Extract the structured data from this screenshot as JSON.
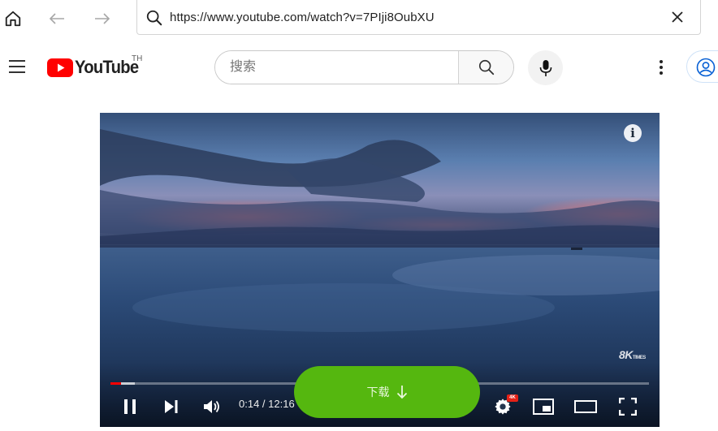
{
  "browser": {
    "url": "https://www.youtube.com/watch?v=7PIji8OubXU",
    "icons": {
      "home": "home-icon",
      "back": "arrow-left-icon",
      "forward": "arrow-right-icon",
      "search": "search-icon",
      "clear": "close-icon"
    }
  },
  "youtube": {
    "logo_text": "YouTube",
    "country_code": "TH",
    "search_placeholder": "搜索",
    "icons": {
      "menu": "hamburger-icon",
      "search": "search-icon",
      "mic": "microphone-icon",
      "more": "more-vert-icon",
      "account": "account-icon"
    }
  },
  "player": {
    "time_display": "0:14 / 12:16",
    "progress_played": 0.019,
    "progress_loaded": 0.045,
    "watermark_text": "8K",
    "watermark_sub": "TIMES",
    "info_glyph": "i",
    "quality_badge": "4K",
    "icons": {
      "pause": "pause-icon",
      "next": "skip-next-icon",
      "volume": "volume-icon",
      "settings": "gear-icon",
      "miniplayer": "miniplayer-icon",
      "theater": "theater-mode-icon",
      "fullscreen": "fullscreen-icon"
    }
  },
  "download_overlay": {
    "label": "下载",
    "icon": "arrow-down-icon",
    "color": "#55b70f"
  },
  "colors": {
    "youtube_red": "#ff0000",
    "progress_red": "#ff0000"
  }
}
